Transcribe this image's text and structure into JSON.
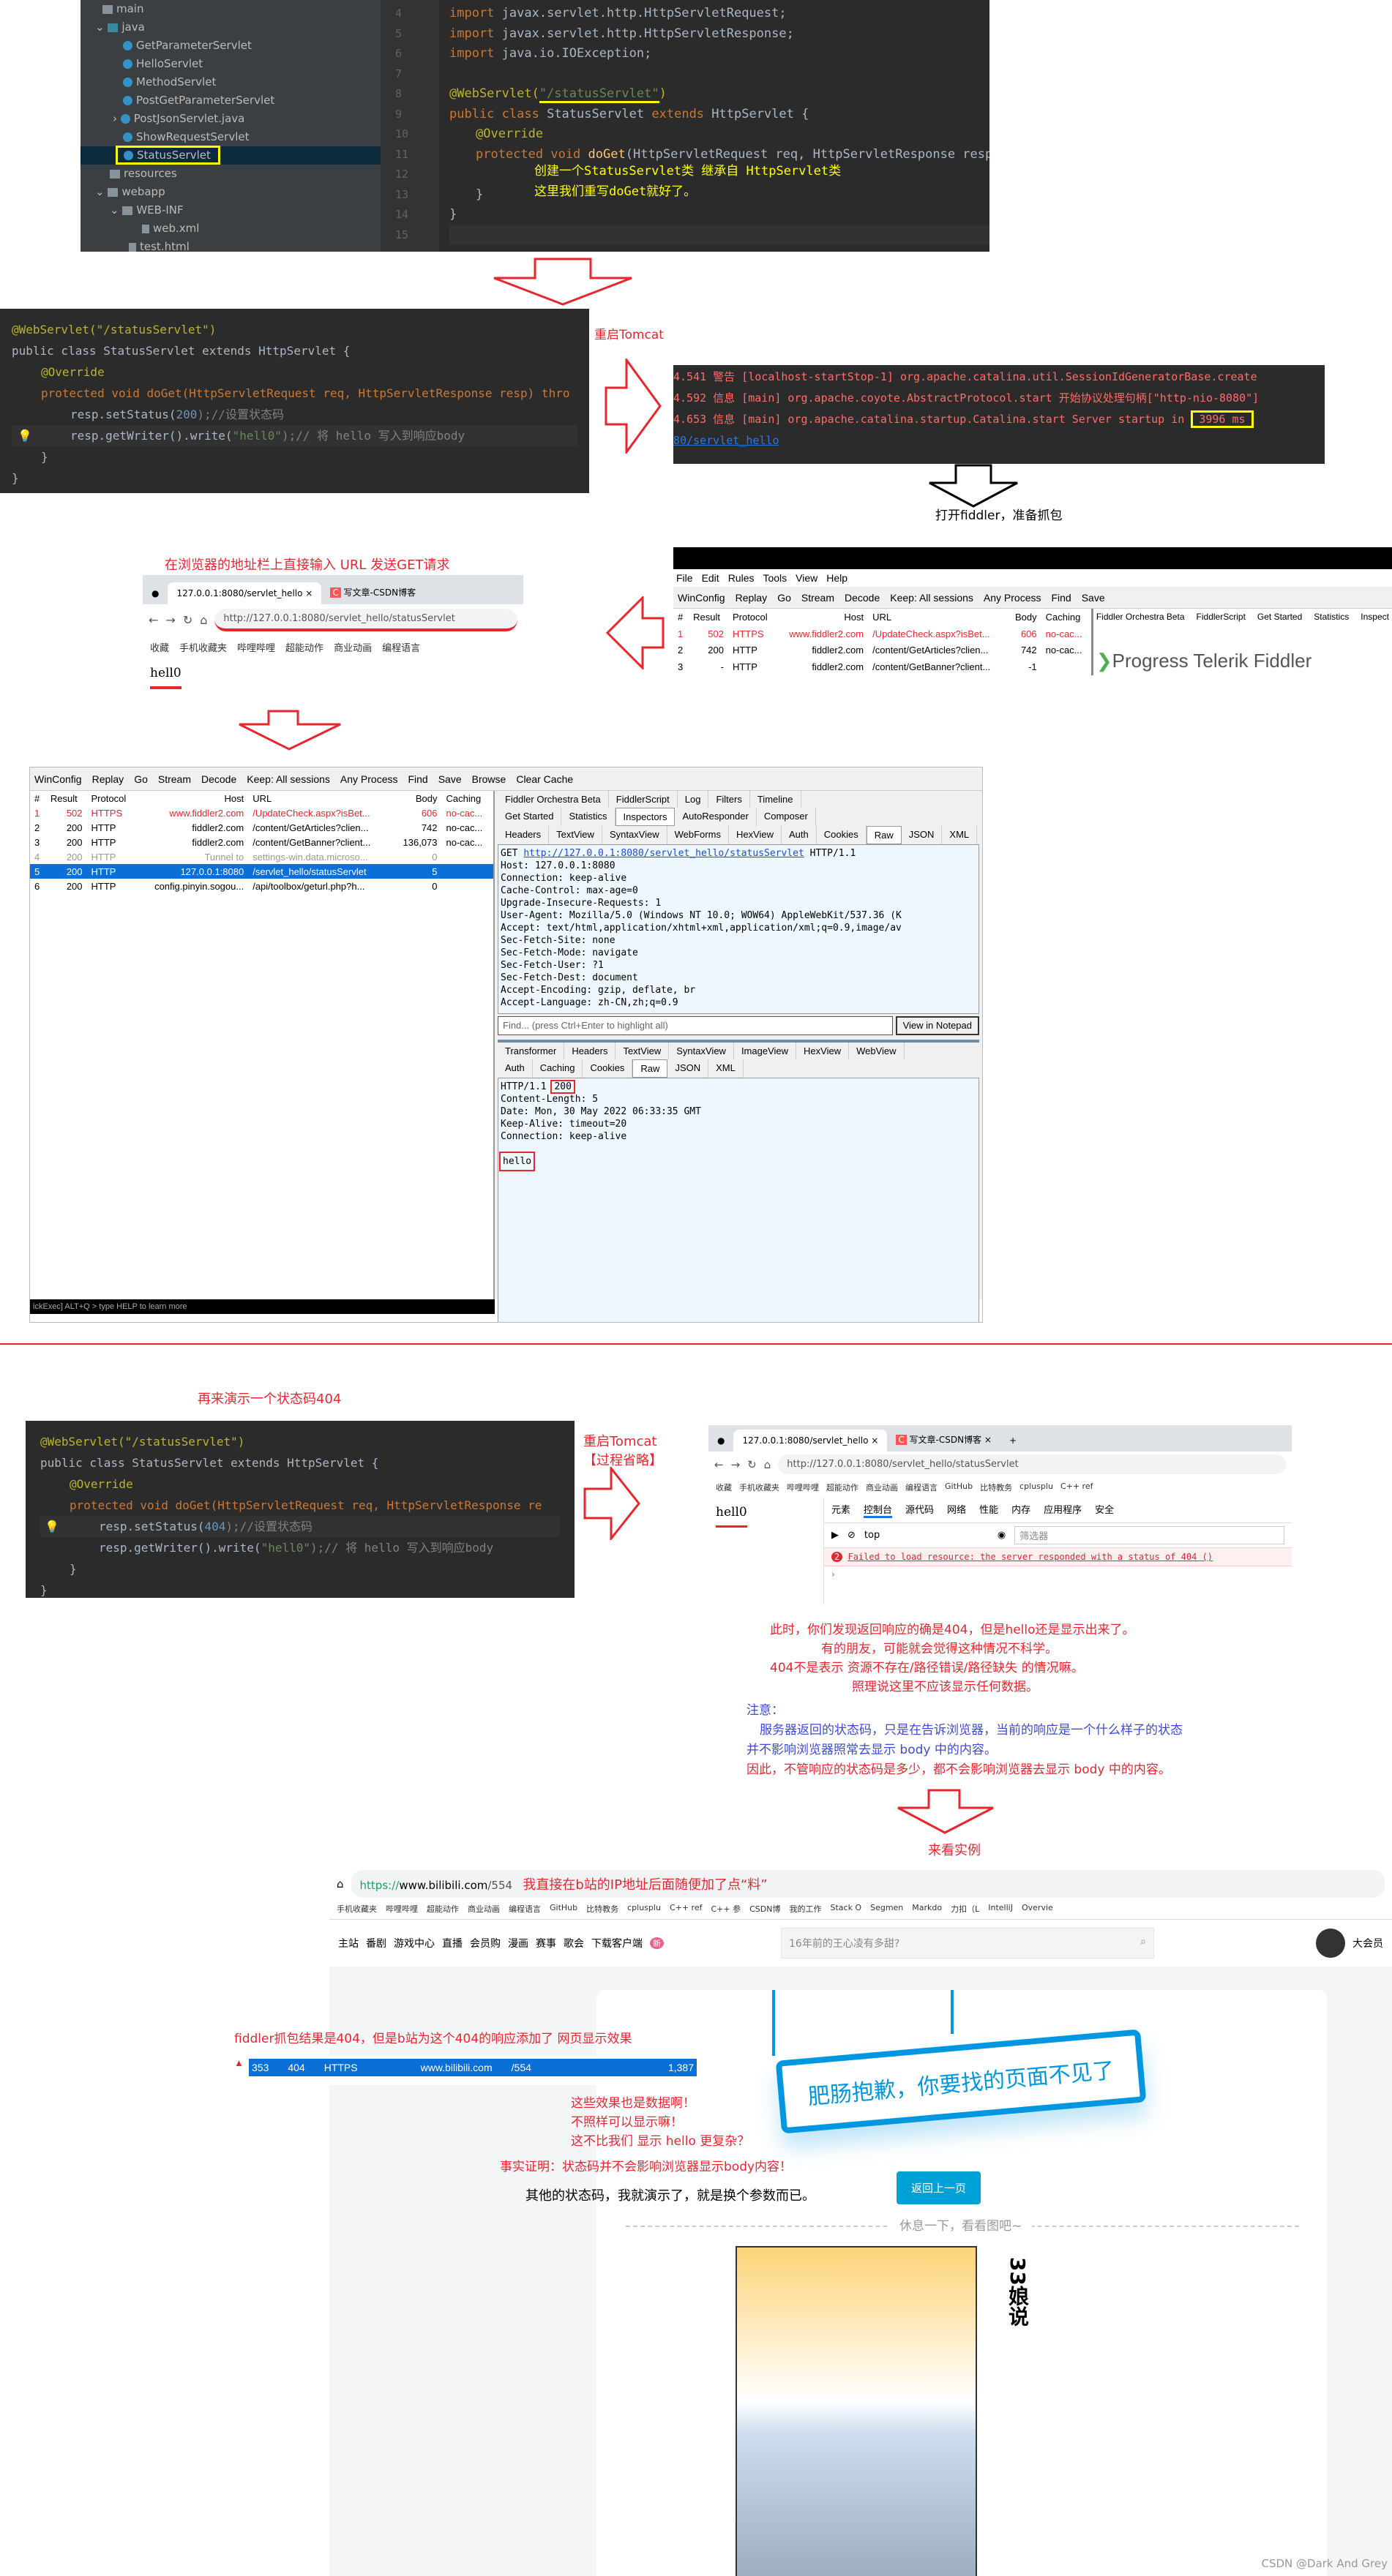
{
  "ide1": {
    "tree": {
      "root": "main",
      "java": "java",
      "files": [
        "GetParameterServlet",
        "HelloServlet",
        "MethodServlet",
        "PostGetParameterServlet",
        "PostJsonServlet.java",
        "ShowRequestServlet",
        "StatusServlet"
      ],
      "resources": "resources",
      "webapp": "webapp",
      "webinf": "WEB-INF",
      "webxml": "web.xml",
      "testhtml": "test.html"
    },
    "line_numbers": [
      "4",
      "5",
      "6",
      "7",
      "8",
      "9",
      "10",
      "11",
      "12",
      "13",
      "14",
      "15"
    ],
    "code": {
      "l4": "javax.servlet.http.HttpServletRequest;",
      "l5": "javax.servlet.http.HttpServletResponse;",
      "l6": "java.io.IOException;",
      "import": "import",
      "ann": "@WebServlet(",
      "path": "\"/statusServlet\"",
      "close": ")",
      "public_class": "public class",
      "cls": "StatusServlet",
      "extends": "extends",
      "parent": "HttpServlet {",
      "override": "@Override",
      "protected_void": "protected void",
      "doget": "doGet",
      "params": "(HttpServletRequest req, HttpServletResponse resp)",
      "brace": "}",
      "brace2": "}"
    },
    "note1": "创建一个StatusServlet类 继承自 HttpServlet类",
    "note2": "这里我们重写doGet就好了。"
  },
  "ide2": {
    "l1": "@WebServlet(\"/statusServlet\")",
    "l2": "public class StatusServlet extends HttpServlet {",
    "l3": "@Override",
    "l4": "protected void doGet(HttpServletRequest req, HttpServletResponse resp) thro",
    "l5a": "resp.setStatus(",
    "l5n": "200",
    "l5c": ");//设置状态码",
    "l6a": "resp.getWriter().write(",
    "l6s": "\"hell0\"",
    "l6c": ");// 将 hello 写入到响应body",
    "l7": "}",
    "l8": "}"
  },
  "restart_tomcat": "重启Tomcat",
  "console": {
    "lines": [
      "4.541 警告 [localhost-startStop-1] org.apache.catalina.util.SessionIdGeneratorBase.create",
      "4.592 信息 [main] org.apache.coyote.AbstractProtocol.start 开始协议处理句柄[\"http-nio-8080\"]",
      "4.653 信息 [main] org.apache.catalina.startup.Catalina.start Server startup in"
    ],
    "startup_time": "3996 ms",
    "link": "80/servlet_hello"
  },
  "open_fiddler": "打开fiddler，准备抓包",
  "browser_hint": "在浏览器的地址栏上直接输入 URL 发送GET请求",
  "browser1": {
    "tab1": "127.0.0.1:8080/servlet_hello",
    "tab2": "写文章-CSDN博客",
    "url": "http://127.0.0.1:8080/servlet_hello/statusServlet",
    "bookmarks": [
      "收藏",
      "手机收藏夹",
      "哔哩哔哩",
      "超能动作",
      "商业动画",
      "编程语言"
    ],
    "body": "hell0"
  },
  "fiddler_small": {
    "menu": [
      "File",
      "Edit",
      "Rules",
      "Tools",
      "View",
      "Help"
    ],
    "toolbar": [
      "WinConfig",
      "Replay",
      "Go",
      "Stream",
      "Decode",
      "Keep: All sessions",
      "Any Process",
      "Find",
      "Save"
    ],
    "headers": [
      "#",
      "Result",
      "Protocol",
      "Host",
      "URL",
      "Body",
      "Caching"
    ],
    "rows": [
      [
        "1",
        "502",
        "HTTPS",
        "www.fiddler2.com",
        "/UpdateCheck.aspx?isBet...",
        "606",
        "no-cac..."
      ],
      [
        "2",
        "200",
        "HTTP",
        "fiddler2.com",
        "/content/GetArticles?clien...",
        "742",
        "no-cac..."
      ],
      [
        "3",
        "-",
        "HTTP",
        "fiddler2.com",
        "/content/GetBanner?client...",
        "-1",
        ""
      ]
    ],
    "right_tabs": [
      "Fiddler Orchestra Beta",
      "FiddlerScript",
      "Get Started",
      "Statistics",
      "Inspect"
    ],
    "logo": "Progress Telerik Fiddler"
  },
  "fiddler_big": {
    "toolbar": [
      "WinConfig",
      "Replay",
      "Go",
      "Stream",
      "Decode",
      "Keep: All sessions",
      "Any Process",
      "Find",
      "Save",
      "Browse",
      "Clear Cache"
    ],
    "headers": [
      "#",
      "Result",
      "Protocol",
      "Host",
      "URL",
      "Body",
      "Caching"
    ],
    "rows": [
      [
        "1",
        "502",
        "HTTPS",
        "www.fiddler2.com",
        "/UpdateCheck.aspx?isBet...",
        "606",
        "no-cac..."
      ],
      [
        "2",
        "200",
        "HTTP",
        "fiddler2.com",
        "/content/GetArticles?clien...",
        "742",
        "no-cac..."
      ],
      [
        "3",
        "200",
        "HTTP",
        "fiddler2.com",
        "/content/GetBanner?client...",
        "136,073",
        "no-cac..."
      ],
      [
        "4",
        "200",
        "HTTP",
        "Tunnel to",
        "settings-win.data.microso...",
        "0",
        ""
      ],
      [
        "5",
        "200",
        "HTTP",
        "127.0.0.1:8080",
        "/servlet_hello/statusServlet",
        "5",
        ""
      ],
      [
        "6",
        "200",
        "HTTP",
        "config.pinyin.sogou...",
        "/api/toolbox/geturl.php?h...",
        "0",
        ""
      ]
    ],
    "top_tabs": [
      "Fiddler Orchestra Beta",
      "FiddlerScript",
      "Log",
      "Filters",
      "Timeline"
    ],
    "main_tabs": [
      "Get Started",
      "Statistics",
      "Inspectors",
      "AutoResponder",
      "Composer"
    ],
    "req_tabs": [
      "Headers",
      "TextView",
      "SyntaxView",
      "WebForms",
      "HexView",
      "Auth",
      "Cookies",
      "Raw",
      "JSON",
      "XML"
    ],
    "request_url": "http://127.0.0.1:8080/servlet_hello/statusServlet",
    "request_method": "GET",
    "request_proto": "HTTP/1.1",
    "request_raw": "Host: 127.0.0.1:8080\nConnection: keep-alive\nCache-Control: max-age=0\nUpgrade-Insecure-Requests: 1\nUser-Agent: Mozilla/5.0 (Windows NT 10.0; WOW64) AppleWebKit/537.36 (K\nAccept: text/html,application/xhtml+xml,application/xml;q=0.9,image/av\nSec-Fetch-Site: none\nSec-Fetch-Mode: navigate\nSec-Fetch-User: ?1\nSec-Fetch-Dest: document\nAccept-Encoding: gzip, deflate, br\nAccept-Language: zh-CN,zh;q=0.9",
    "find_placeholder": "Find... (press Ctrl+Enter to highlight all)",
    "view_notepad": "View in Notepad",
    "resp_tabs1": [
      "Transformer",
      "Headers",
      "TextView",
      "SyntaxView",
      "ImageView",
      "HexView",
      "WebView"
    ],
    "resp_tabs2": [
      "Auth",
      "Caching",
      "Cookies",
      "Raw",
      "JSON",
      "XML"
    ],
    "resp_status_prefix": "HTTP/1.1",
    "resp_status": "200",
    "response_raw": "Content-Length: 5\nDate: Mon, 30 May 2022 06:33:35 GMT\nKeep-Alive: timeout=20\nConnection: keep-alive",
    "resp_body": "hello",
    "statusbar": "ickExec] ALT+Q > type HELP to learn more"
  },
  "demo404_title": "再来演示一个状态码404",
  "ide3": {
    "l1": "@WebServlet(\"/statusServlet\")",
    "l2": "public class StatusServlet extends HttpServlet {",
    "l3": "@Override",
    "l4": "protected void doGet(HttpServletRequest req, HttpServletResponse re",
    "l5a": "resp.setStatus(",
    "l5n": "404",
    "l5c": ");//设置状态码",
    "l6a": "resp.getWriter().write(",
    "l6s": "\"hell0\"",
    "l6c": ");// 将 hello 写入到响应body",
    "l7": "}",
    "l8": "}"
  },
  "restart2": {
    "l1": "重启Tomcat",
    "l2": "【过程省略】"
  },
  "browser2": {
    "tab1": "127.0.0.1:8080/servlet_hello",
    "tab2": "写文章-CSDN博客",
    "url": "http://127.0.0.1:8080/servlet_hello/statusServlet",
    "bookmarks": [
      "收藏",
      "手机收藏夹",
      "哔哩哔哩",
      "超能动作",
      "商业动画",
      "编程语言",
      "GitHub",
      "比特教务",
      "cplusplu",
      "C++ ref"
    ],
    "body": "hell0",
    "devtools_tabs": [
      "元素",
      "控制台",
      "源代码",
      "网络",
      "性能",
      "内存",
      "应用程序",
      "安全"
    ],
    "context": "top",
    "filter_placeholder": "筛选器",
    "error_count": "2",
    "error": "Failed to load resource: the server responded with a status of 404 ()"
  },
  "explain": {
    "red": [
      "此时，你们发现返回响应的确是404，但是hello还是显示出来了。",
      "有的朋友，可能就会觉得这种情况不科学。",
      "404不是表示 资源不存在/路径错误/路径缺失 的情况嘛。",
      "照理说这里不应该显示任何数据。"
    ],
    "note_title": "注意：",
    "blue": [
      "服务器返回的状态码，只是在告诉浏览器，当前的响应是一个什么样子的状态",
      "并不影响浏览器照常去显示 body 中的内容。"
    ],
    "conclusion": "因此，不管响应的状态码是多少，都不会影响浏览器去显示 body 中的内容。"
  },
  "see_example": "来看实例",
  "bili": {
    "url_scheme": "https://",
    "url_host": "www.bilibili.com",
    "url_path": "/554",
    "url_note": "我直接在b站的IP地址后面随便加了点“料”",
    "bookmarks": [
      "手机收藏夹",
      "哔哩哔哩",
      "超能动作",
      "商业动画",
      "编程语言",
      "GitHub",
      "比特教务",
      "cplusplu",
      "C++ ref",
      "C++ 参",
      "CSDN博",
      "我的工作",
      "Stack O",
      "Segmen",
      "Markdo",
      "力扣（L",
      "IntelliJ",
      "Overvie"
    ],
    "nav": [
      "主站",
      "番剧",
      "游戏中心",
      "直播",
      "会员购",
      "漫画",
      "赛事",
      "歌会",
      "下载客户端"
    ],
    "new_badge": "新",
    "search_placeholder": "16年前的王心凌有多甜?",
    "user": "大会员",
    "sign": "肥肠抱歉，你要找的页面不见了",
    "back": "返回上一页",
    "rest": "休息一下，看看图吧~",
    "comic_side": "33娘说"
  },
  "fiddler_note": "fiddler抓包结果是404，但是b站为这个404的响应添加了 网页显示效果",
  "bili_row": [
    "353",
    "404",
    "HTTPS",
    "www.bilibili.com",
    "/554",
    "1,387"
  ],
  "bili_notes": [
    "这些效果也是数据啊！",
    "不照样可以显示嘛！",
    "这不比我们 显示 hello 更复杂？"
  ],
  "proof": "事实证明：状态码并不会影响浏览器显示body内容！",
  "others": "其他的状态码，我就演示了，就是换个参数而已。",
  "watermark": "CSDN @Dark And Grey",
  "colors": {
    "annotation_red": "#e8262d",
    "annotation_blue": "#3d4bd1",
    "highlight_yellow": "#ffff00",
    "fiddler_select": "#0a6fd6",
    "bili_blue": "#00a1d6"
  }
}
